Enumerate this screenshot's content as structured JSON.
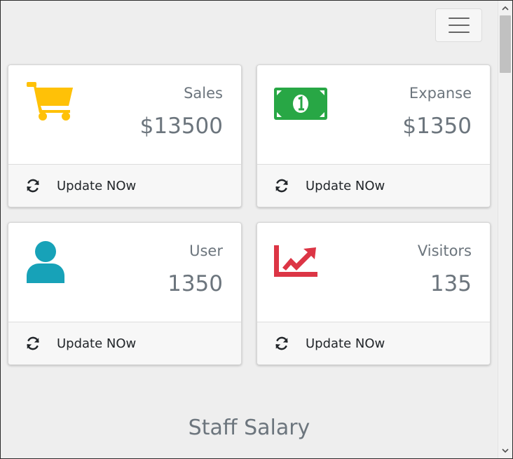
{
  "navbar": {
    "menu_icon": "hamburger-menu-icon"
  },
  "cards": [
    {
      "title": "Sales",
      "value": "$13500",
      "icon": "shopping-cart-icon",
      "icon_color": "#ffc107",
      "footer_icon": "sync-icon",
      "footer_label": "Update NOw"
    },
    {
      "title": "Expanse",
      "value": "$1350",
      "icon": "money-bill-icon",
      "icon_color": "#28a745",
      "footer_icon": "sync-icon",
      "footer_label": "Update NOw"
    },
    {
      "title": "User",
      "value": "1350",
      "icon": "user-icon",
      "icon_color": "#17a2b8",
      "footer_icon": "sync-icon",
      "footer_label": "Update NOw"
    },
    {
      "title": "Visitors",
      "value": "135",
      "icon": "chart-line-icon",
      "icon_color": "#dc3545",
      "footer_icon": "sync-icon",
      "footer_label": "Update NOw"
    }
  ],
  "section": {
    "title": "Staff Salary"
  },
  "colors": {
    "page_background": "#eeeeee",
    "muted_text": "#6c757d",
    "footer_background": "#f7f7f7"
  }
}
